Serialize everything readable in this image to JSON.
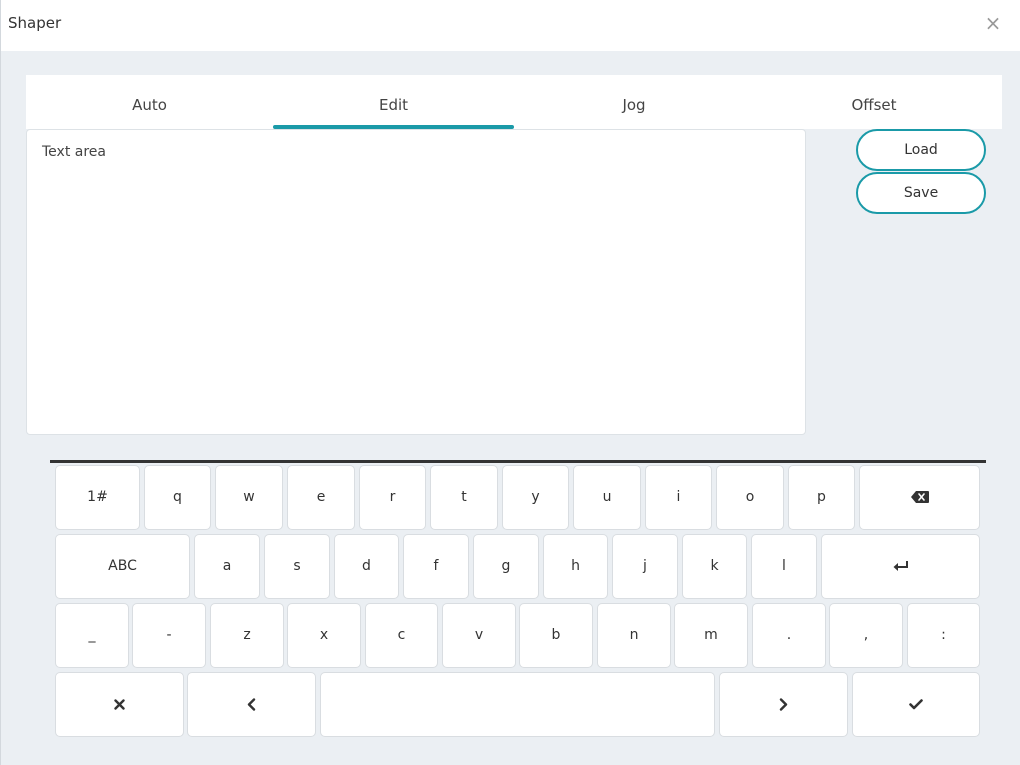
{
  "window": {
    "title": "Shaper",
    "close_icon": "×"
  },
  "tabs": [
    {
      "label": "Auto"
    },
    {
      "label": "Edit",
      "active": true
    },
    {
      "label": "Jog"
    },
    {
      "label": "Offset"
    }
  ],
  "editor": {
    "text": "Text area"
  },
  "actions": {
    "load_label": "Load",
    "save_label": "Save"
  },
  "keyboard": {
    "row1": [
      "1#",
      "q",
      "w",
      "e",
      "r",
      "t",
      "y",
      "u",
      "i",
      "o",
      "p"
    ],
    "row2": [
      "ABC",
      "a",
      "s",
      "d",
      "f",
      "g",
      "h",
      "j",
      "k",
      "l"
    ],
    "row3": [
      "_",
      "-",
      "z",
      "x",
      "c",
      "v",
      "b",
      "n",
      "m",
      ".",
      ",",
      ":"
    ],
    "icons": {
      "backspace": "backspace-icon",
      "enter": "enter-icon",
      "close": "close-icon",
      "left": "chevron-left-icon",
      "right": "chevron-right-icon",
      "confirm": "checkmark-icon"
    },
    "accent_color": "#1a9aa8"
  }
}
